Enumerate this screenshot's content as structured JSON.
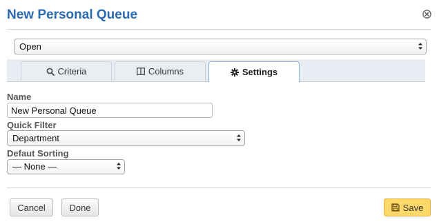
{
  "dialog": {
    "title": "New Personal Queue"
  },
  "view_select": {
    "value": "Open"
  },
  "tabs": [
    {
      "label": "Criteria",
      "icon": "search-icon"
    },
    {
      "label": "Columns",
      "icon": "columns-icon"
    },
    {
      "label": "Settings",
      "icon": "gear-icon",
      "active": true
    }
  ],
  "settings": {
    "name_label": "Name",
    "name_value": "New Personal Queue",
    "quick_filter_label": "Quick Filter",
    "quick_filter_value": "Department",
    "sorting_label": "Defaut Sorting",
    "sorting_value": "— None —"
  },
  "footer": {
    "cancel_label": "Cancel",
    "done_label": "Done",
    "save_label": "Save"
  },
  "colors": {
    "title": "#2a6aaf",
    "save_button": "#fdd86a",
    "tabbar": "#e7edf2"
  }
}
